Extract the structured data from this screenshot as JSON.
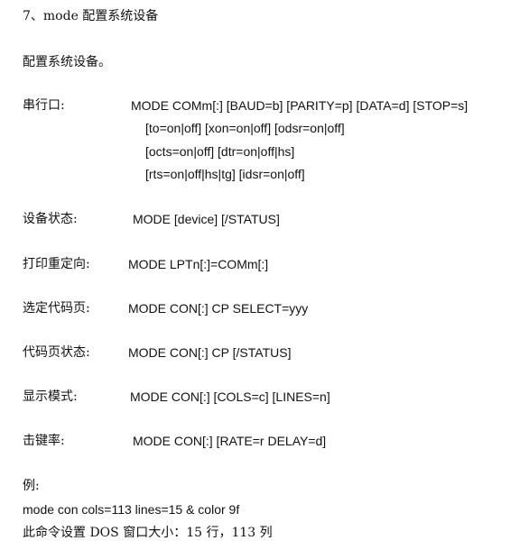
{
  "heading": "7、mode 配置系统设备",
  "intro": "配置系统设备。",
  "sections": [
    {
      "label": "串行口:",
      "lines": [
        "MODE COMm[:] [BAUD=b] [PARITY=p] [DATA=d] [STOP=s]",
        "[to=on|off] [xon=on|off] [odsr=on|off]",
        "[octs=on|off] [dtr=on|off|hs]",
        "[rts=on|off|hs|tg] [idsr=on|off]"
      ]
    },
    {
      "label": "设备状态:",
      "lines": [
        "MODE [device] [/STATUS]"
      ]
    },
    {
      "label": "打印重定向:",
      "lines": [
        "MODE LPTn[:]=COMm[:]"
      ]
    },
    {
      "label": "选定代码页:",
      "lines": [
        "MODE CON[:] CP SELECT=yyy"
      ]
    },
    {
      "label": "代码页状态:",
      "lines": [
        "MODE CON[:] CP [/STATUS]"
      ]
    },
    {
      "label": "显示模式:",
      "lines": [
        "MODE CON[:] [COLS=c] [LINES=n]"
      ]
    },
    {
      "label": "击键率:",
      "lines": [
        "MODE CON[:] [RATE=r DELAY=d]"
      ]
    }
  ],
  "example": {
    "label": "例:",
    "command": "mode con cols=113 lines=15 & color 9f",
    "note": "此命令设置 DOS 窗口大小：15 行，113 列"
  }
}
